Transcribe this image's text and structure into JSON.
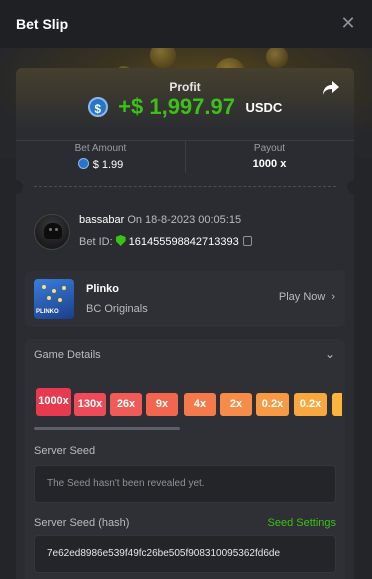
{
  "modal": {
    "title": "Bet Slip",
    "close_icon": "close-icon"
  },
  "profit": {
    "label": "Profit",
    "currency_icon_glyph": "$",
    "value": "+$ 1,997.97",
    "currency": "USDC"
  },
  "stats": {
    "bet_amount_label": "Bet Amount",
    "bet_amount_value": "$ 1.99",
    "payout_label": "Payout",
    "payout_value": "1000 x"
  },
  "user": {
    "name": "bassabar",
    "date": "On 18-8-2023 00:05:15",
    "bet_id_label": "Bet ID:",
    "bet_id": "161455598842713393"
  },
  "game": {
    "name": "Plinko",
    "provider": "BC Originals",
    "play_label": "Play Now",
    "thumb_logo": "PLINKO"
  },
  "details": {
    "title": "Game Details",
    "multipliers": [
      {
        "label": "1000x",
        "color": "#e73a4f"
      },
      {
        "label": "130x",
        "color": "#ef4a5a"
      },
      {
        "label": "26x",
        "color": "#f05a57"
      },
      {
        "label": "9x",
        "color": "#f2664f"
      },
      {
        "label": "4x",
        "color": "#f47a4b"
      },
      {
        "label": "2x",
        "color": "#f68c47"
      },
      {
        "label": "0.2x",
        "color": "#f79a43"
      },
      {
        "label": "0.2x",
        "color": "#f9a83f"
      },
      {
        "label": "",
        "color": "#fbb53a"
      }
    ],
    "server_seed_label": "Server Seed",
    "server_seed_value": "The Seed hasn't been revealed yet.",
    "server_seed_hash_label": "Server Seed (hash)",
    "seed_settings_label": "Seed Settings",
    "server_seed_hash_value": "7e62ed8986e539f49fc26be505f908310095362fd6de"
  },
  "colors": {
    "profit_green": "#3bc117",
    "accent_green": "#3bc117",
    "background": "#232529"
  }
}
